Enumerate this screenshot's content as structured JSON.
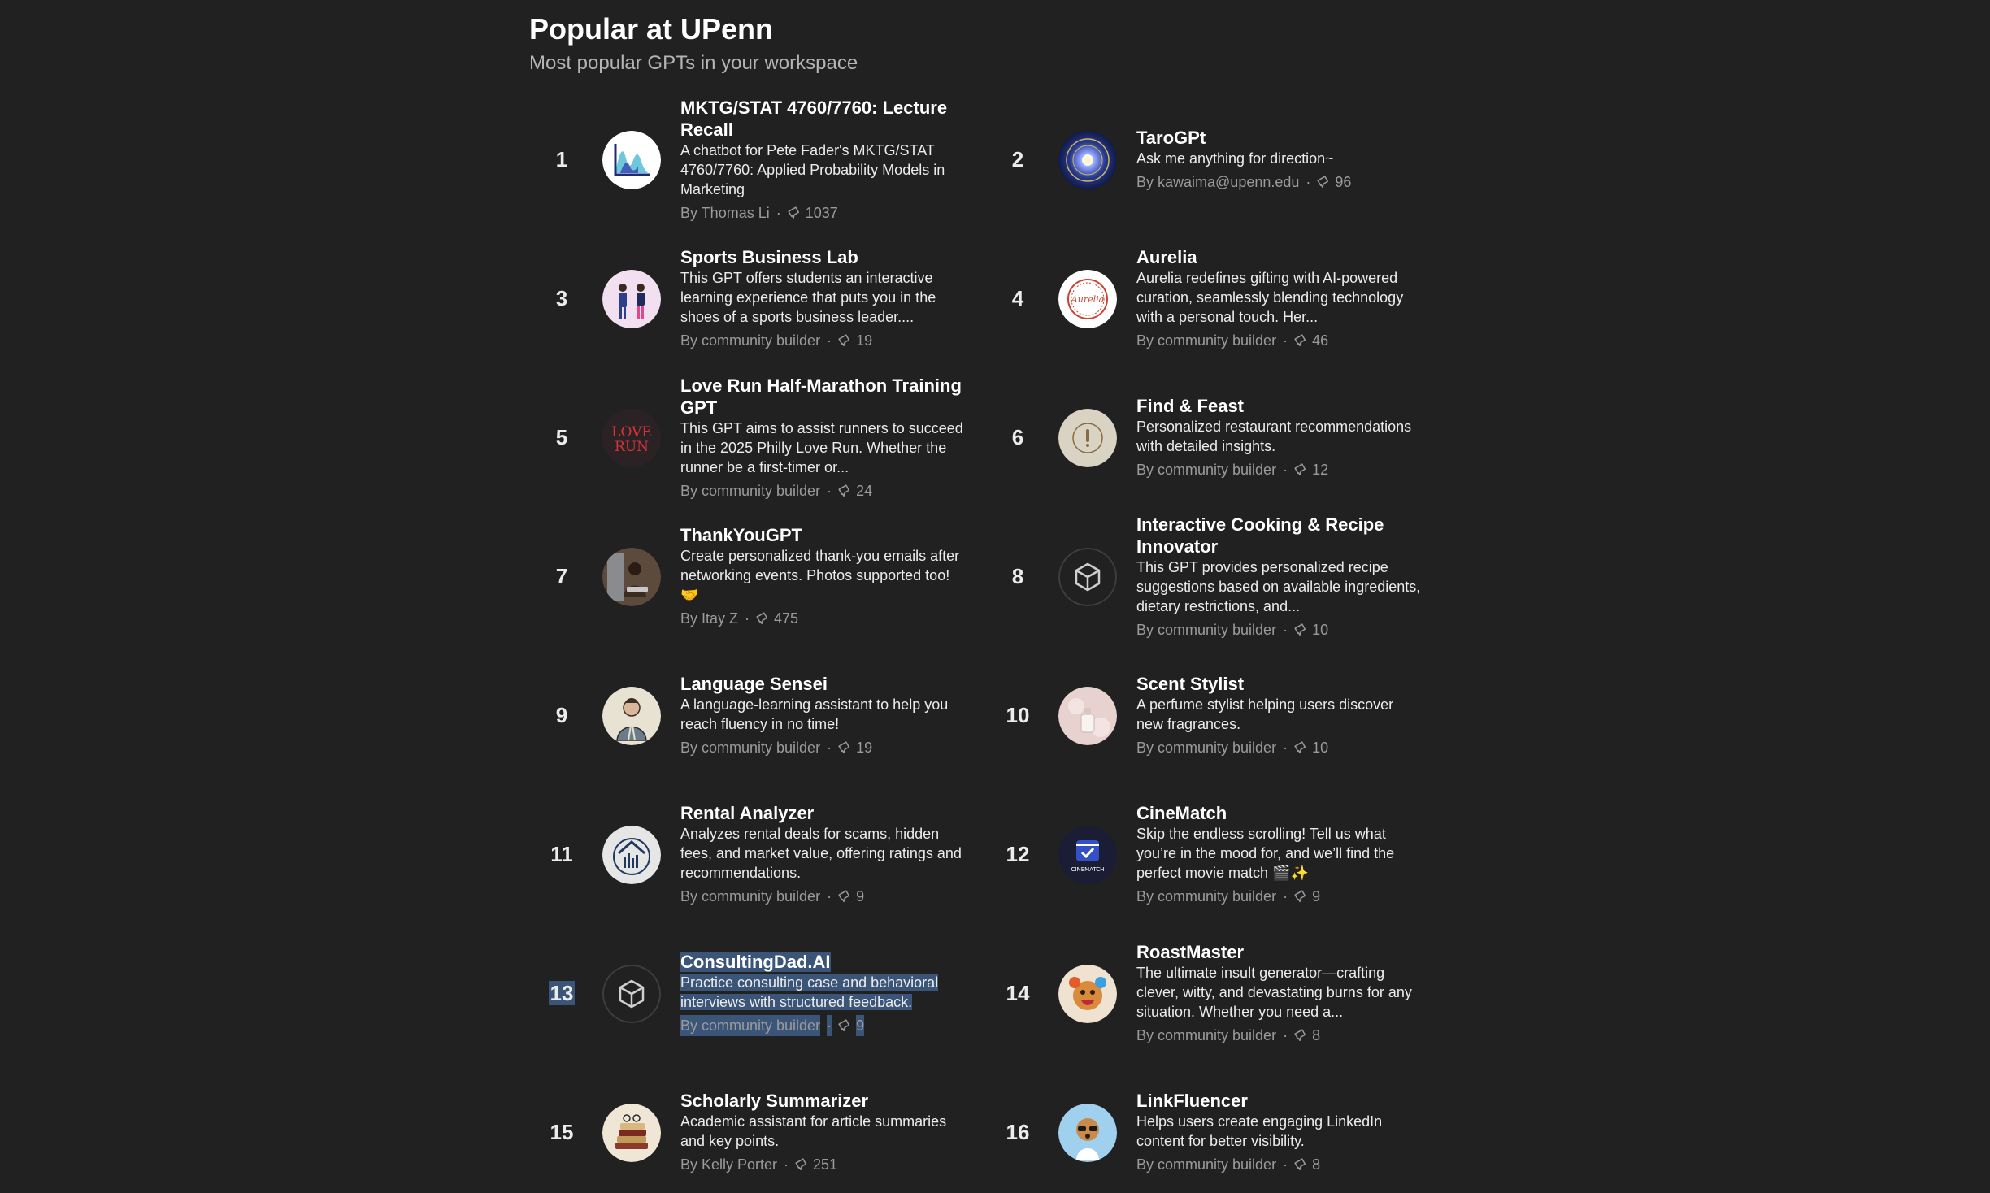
{
  "section": {
    "title": "Popular at UPenn",
    "subtitle": "Most popular GPTs in your workspace"
  },
  "colors": {
    "background": "#212121",
    "selection": "#3b5579",
    "muted_text": "#9b9b9b"
  },
  "gpts": [
    {
      "rank": "1",
      "name": "MKTG/STAT 4760/7760: Lecture Recall",
      "description": "A chatbot for Pete Fader's MKTG/STAT 4760/7760: Applied Probability Models in Marketing",
      "author": "By Thomas Li",
      "chats": "1037",
      "icon": "chart-logo-icon"
    },
    {
      "rank": "2",
      "name": "TaroGPt",
      "description": "Ask me anything for direction~",
      "author": "By kawaima@upenn.edu",
      "chats": "96",
      "icon": "cosmic-tarot-icon"
    },
    {
      "rank": "3",
      "name": "Sports Business Lab",
      "description": "This GPT offers students an interactive learning experience that puts you in the shoes of a sports business leader....",
      "author": "By community builder",
      "chats": "19",
      "icon": "business-people-icon"
    },
    {
      "rank": "4",
      "name": "Aurelia",
      "description": "Aurelia redefines gifting with AI-powered curation, seamlessly blending technology with a personal touch. Her...",
      "author": "By community builder",
      "chats": "46",
      "icon": "aurelia-badge-icon"
    },
    {
      "rank": "5",
      "name": "Love Run Half-Marathon Training GPT",
      "description": "This GPT aims to assist runners to succeed in the 2025 Philly Love Run. Whether the runner be a first-timer or...",
      "author": "By community builder",
      "chats": "24",
      "icon": "love-run-logo-icon"
    },
    {
      "rank": "6",
      "name": "Find & Feast",
      "description": "Personalized restaurant recommendations with detailed insights.",
      "author": "By community builder",
      "chats": "12",
      "icon": "feast-plate-icon"
    },
    {
      "rank": "7",
      "name": "ThankYouGPT",
      "description": "Create personalized thank-you emails after networking events. Photos supported too! 🤝",
      "author": "By Itay Z",
      "chats": "475",
      "icon": "person-laptop-icon"
    },
    {
      "rank": "8",
      "name": "Interactive Cooking & Recipe Innovator",
      "description": "This GPT provides personalized recipe suggestions based on available ingredients, dietary restrictions, and...",
      "author": "By community builder",
      "chats": "10",
      "icon": "cube-placeholder-icon"
    },
    {
      "rank": "9",
      "name": "Language Sensei",
      "description": "A language-learning assistant to help you reach fluency in no time!",
      "author": "By community builder",
      "chats": "19",
      "icon": "sensei-portrait-icon"
    },
    {
      "rank": "10",
      "name": "Scent Stylist",
      "description": "A perfume stylist helping users discover new fragrances.",
      "author": "By community builder",
      "chats": "10",
      "icon": "perfume-bottle-icon"
    },
    {
      "rank": "11",
      "name": "Rental Analyzer",
      "description": "Analyzes rental deals for scams, hidden fees, and market value, offering ratings and recommendations.",
      "author": "By community builder",
      "chats": "9",
      "icon": "house-chart-icon"
    },
    {
      "rank": "12",
      "name": "CineMatch",
      "description": "Skip the endless scrolling! Tell us what you’re in the mood for, and we’ll find the perfect movie match 🎬✨",
      "author": "By community builder",
      "chats": "9",
      "icon": "cinematch-clapper-icon",
      "icon_label": "CINEMATCH"
    },
    {
      "rank": "13",
      "name": "ConsultingDad.AI",
      "description": "Practice consulting case and behavioral interviews with structured feedback.",
      "author": "By community builder",
      "chats": "9",
      "icon": "cube-placeholder-icon",
      "selected": true
    },
    {
      "rank": "14",
      "name": "RoastMaster",
      "description": "The ultimate insult generator—crafting clever, witty, and devastating burns for any situation. Whether you need a...",
      "author": "By community builder",
      "chats": "8",
      "icon": "laughing-dog-icon"
    },
    {
      "rank": "15",
      "name": "Scholarly Summarizer",
      "description": "Academic assistant for article summaries and key points.",
      "author": "By Kelly Porter",
      "chats": "251",
      "icon": "book-stack-icon"
    },
    {
      "rank": "16",
      "name": "LinkFluencer",
      "description": "Helps users create engaging LinkedIn content for better visibility.",
      "author": "By community builder",
      "chats": "8",
      "icon": "dog-sunglasses-icon"
    }
  ]
}
